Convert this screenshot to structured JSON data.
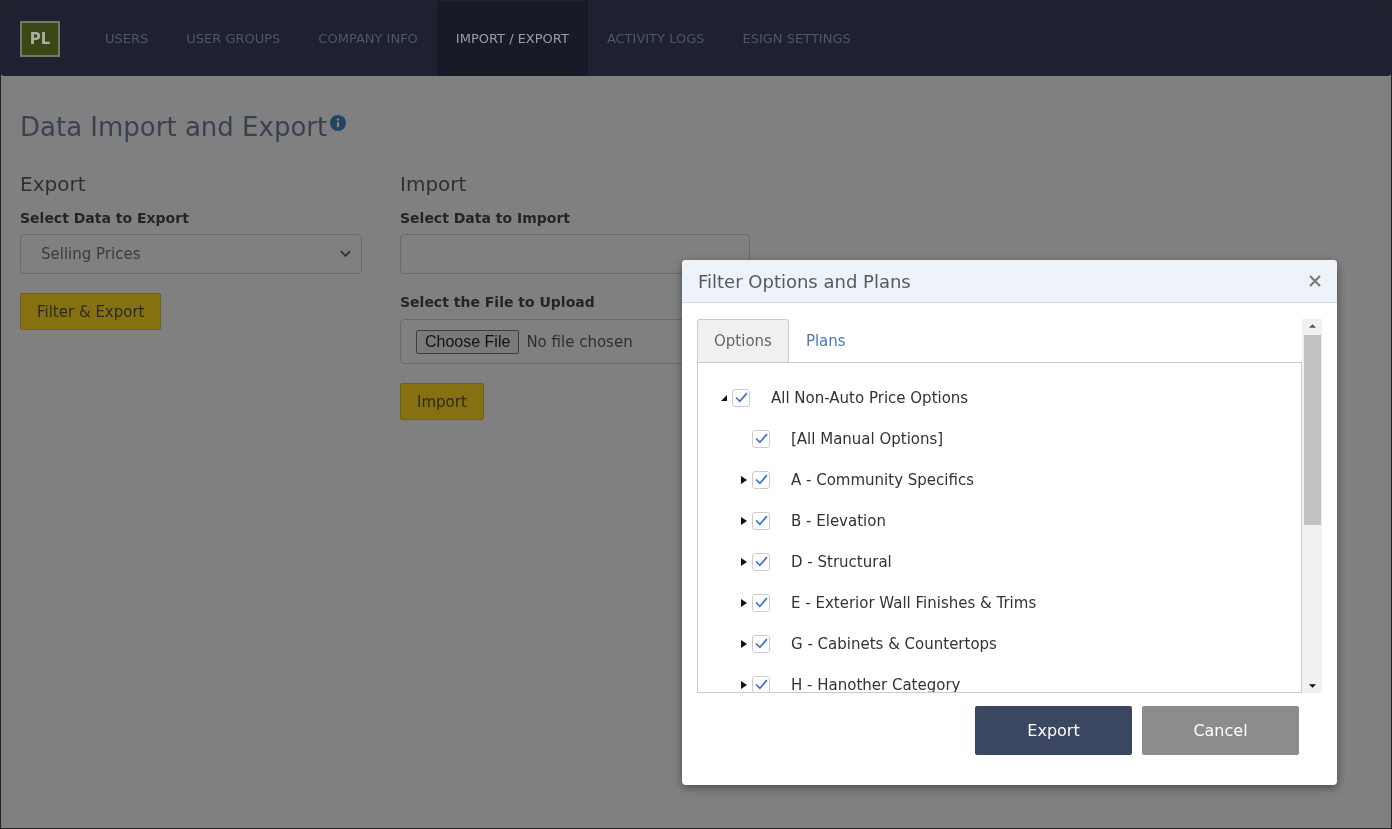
{
  "logo": "PL",
  "nav": [
    {
      "label": "USERS",
      "selected": false
    },
    {
      "label": "USER GROUPS",
      "selected": false
    },
    {
      "label": "COMPANY INFO",
      "selected": false
    },
    {
      "label": "IMPORT / EXPORT",
      "selected": true
    },
    {
      "label": "ACTIVITY LOGS",
      "selected": false
    },
    {
      "label": "ESIGN SETTINGS",
      "selected": false
    }
  ],
  "page_title": "Data Import and Export",
  "export": {
    "heading": "Export",
    "label": "Select Data to Export",
    "value": "Selling Prices",
    "button": "Filter & Export"
  },
  "import": {
    "heading": "Import",
    "label": "Select Data to Import",
    "file_label": "Select the File to Upload",
    "choose_button": "Choose File",
    "file_status": "No file chosen",
    "button": "Import"
  },
  "dialog": {
    "title": "Filter Options and Plans",
    "tabs": [
      {
        "label": "Options",
        "selected": true
      },
      {
        "label": "Plans",
        "selected": false
      }
    ],
    "tree": [
      {
        "label": "All Non-Auto Price Options",
        "kind": "group",
        "expanded": true,
        "checked": true,
        "children": [
          {
            "label": "[All Manual Options]",
            "kind": "leaf",
            "checked": true
          },
          {
            "label": "A - Community Specifics",
            "kind": "group",
            "expanded": false,
            "checked": true
          },
          {
            "label": "B - Elevation",
            "kind": "group",
            "expanded": false,
            "checked": true
          },
          {
            "label": "D - Structural",
            "kind": "group",
            "expanded": false,
            "checked": true
          },
          {
            "label": "E - Exterior Wall Finishes & Trims",
            "kind": "group",
            "expanded": false,
            "checked": true
          },
          {
            "label": "G - Cabinets & Countertops",
            "kind": "group",
            "expanded": false,
            "checked": true
          },
          {
            "label": "H - Hanother Category",
            "kind": "group",
            "expanded": false,
            "checked": true
          }
        ]
      }
    ],
    "buttons": [
      {
        "label": "Export",
        "kind": "primary"
      },
      {
        "label": "Cancel",
        "kind": "secondary"
      }
    ]
  }
}
